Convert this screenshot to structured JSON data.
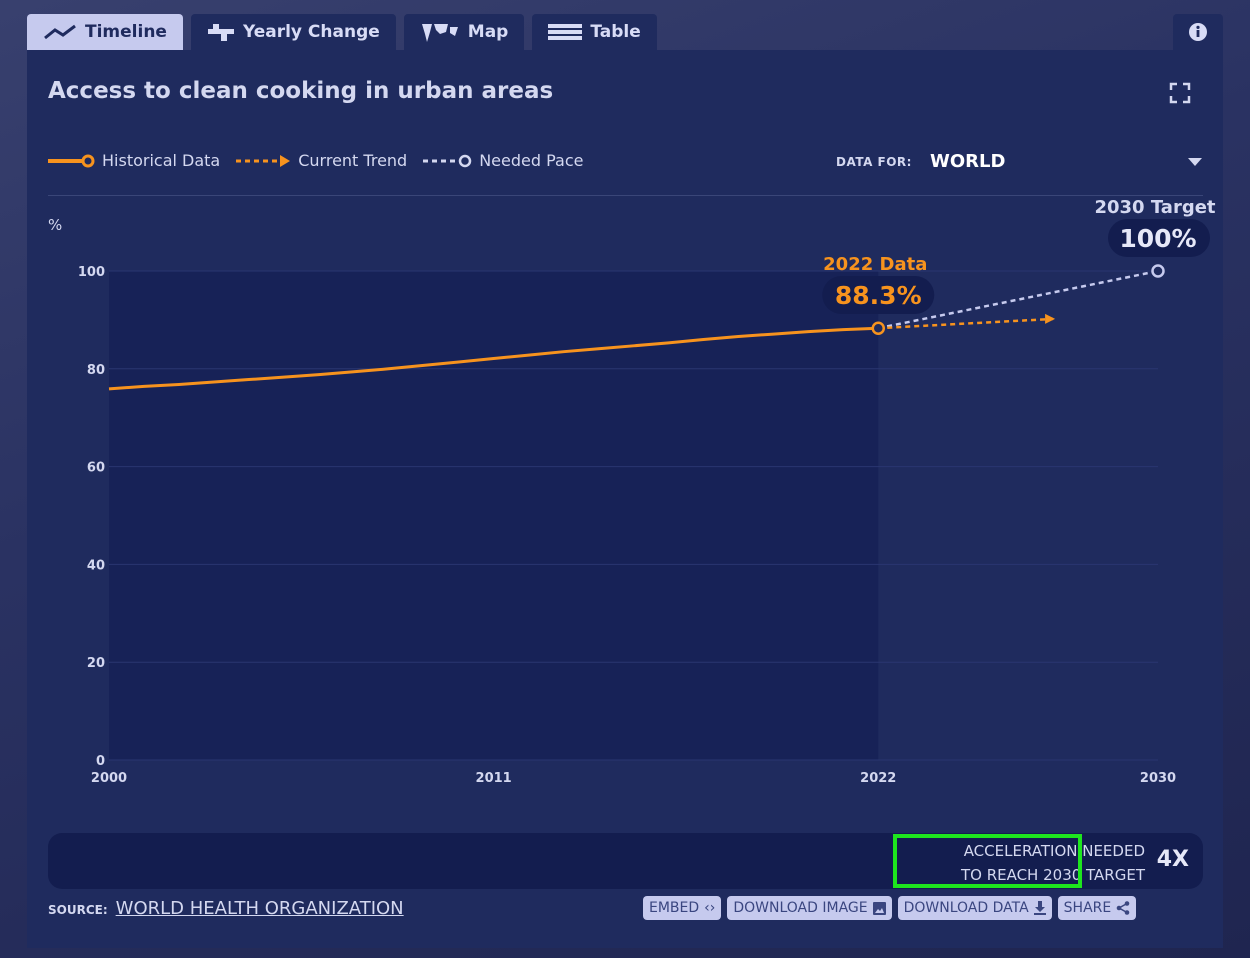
{
  "tabs": [
    {
      "label": "Timeline",
      "icon": "trend-line-icon",
      "active": true
    },
    {
      "label": "Yearly Change",
      "icon": "bar-change-icon"
    },
    {
      "label": "Map",
      "icon": "world-map-icon"
    },
    {
      "label": "Table",
      "icon": "table-icon"
    }
  ],
  "title": "Access to clean cooking in urban areas",
  "legend": {
    "historical": "Historical Data",
    "trend": "Current Trend",
    "needed": "Needed Pace"
  },
  "data_for": {
    "label": "DATA FOR:",
    "value": "WORLD"
  },
  "colors": {
    "historical": "#f7931e",
    "needed": "#c6caee",
    "background": "#1f2b5e",
    "plot": "#172257"
  },
  "chart_data": {
    "type": "line",
    "ylabel": "%",
    "ylim": [
      0,
      100
    ],
    "yticks": [
      0,
      20,
      40,
      60,
      80,
      100
    ],
    "xticks": [
      2000,
      2011,
      2022,
      2030
    ],
    "xlim": [
      2000,
      2030
    ],
    "grid": true,
    "series": [
      {
        "name": "Historical Data",
        "x": [
          2000,
          2001,
          2002,
          2003,
          2004,
          2005,
          2006,
          2007,
          2008,
          2009,
          2010,
          2011,
          2012,
          2013,
          2014,
          2015,
          2016,
          2017,
          2018,
          2019,
          2020,
          2021,
          2022
        ],
        "values": [
          75.9,
          76.4,
          76.8,
          77.3,
          77.8,
          78.3,
          78.8,
          79.4,
          80.0,
          80.7,
          81.4,
          82.1,
          82.8,
          83.5,
          84.1,
          84.7,
          85.3,
          86.0,
          86.6,
          87.1,
          87.6,
          88.0,
          88.3
        ]
      },
      {
        "name": "Current Trend",
        "x": [
          2022,
          2027
        ],
        "values": [
          88.3,
          90.2
        ]
      },
      {
        "name": "Needed Pace",
        "x": [
          2022,
          2030
        ],
        "values": [
          88.3,
          100
        ]
      }
    ],
    "annotations": [
      {
        "label": "2022 Data",
        "value": "88.3%"
      },
      {
        "label": "2030 Target",
        "value": "100%"
      }
    ]
  },
  "acceleration": {
    "line1": "ACCELERATION NEEDED",
    "line2": "TO REACH 2030 TARGET",
    "value": "4X"
  },
  "source": {
    "label": "SOURCE:",
    "value": "WORLD HEALTH ORGANIZATION"
  },
  "buttons": {
    "embed": "EMBED",
    "download_image": "DOWNLOAD IMAGE",
    "download_data": "DOWNLOAD DATA",
    "share": "SHARE"
  }
}
